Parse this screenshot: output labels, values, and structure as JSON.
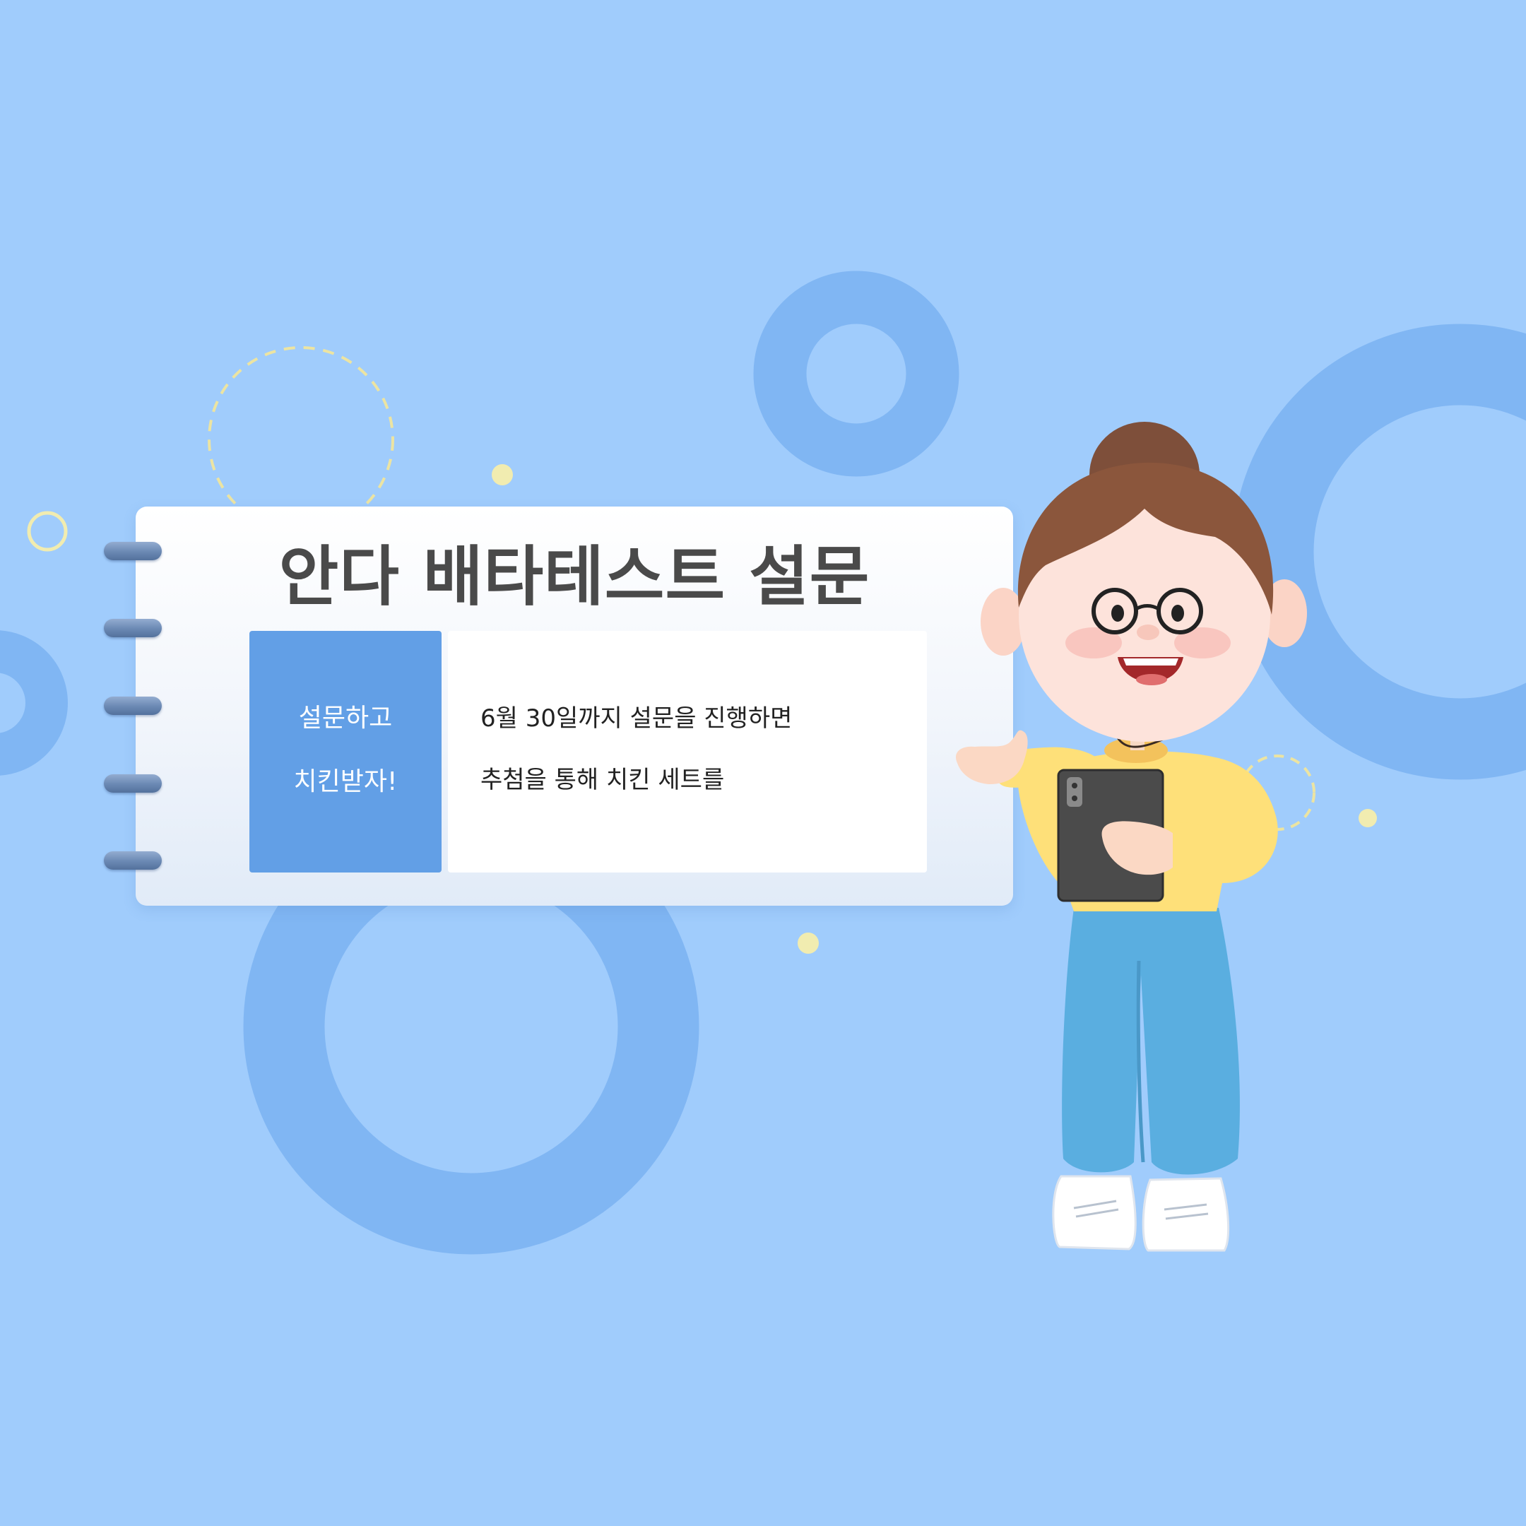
{
  "colors": {
    "background": "#a0ccfc",
    "ring_blue": "#80b6f3",
    "accent_yellow": "#f1ecb0",
    "tag_blue": "#629fe6",
    "title_text": "#4a4a4a",
    "binder_ring": "#6a88b3"
  },
  "card": {
    "title": "안다 배타테스트 설문",
    "tag_lines": [
      "설문하고",
      "치킨받자!"
    ],
    "description_lines": [
      "6월 30일까지 설문을 진행하면",
      "추첨을 통해 치킨 세트를"
    ]
  },
  "illustration": {
    "subject": "woman-with-tablet-character"
  }
}
